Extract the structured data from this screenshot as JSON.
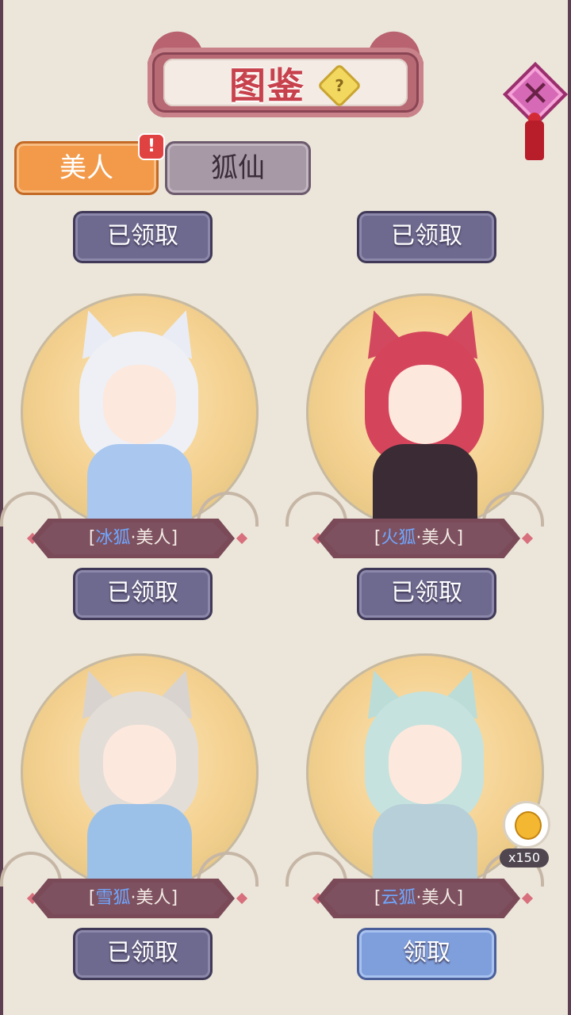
{
  "header": {
    "title": "图鉴",
    "help_icon": "?"
  },
  "close_icon": "✕",
  "tabs": [
    {
      "label": "美人",
      "active": true,
      "alert": "!"
    },
    {
      "label": "狐仙",
      "active": false
    }
  ],
  "top_row_buttons": [
    "已领取",
    "已领取"
  ],
  "cards": [
    {
      "prefix": "[",
      "fox": "冰狐",
      "dot": "·",
      "title": "美人",
      "suffix": "]",
      "button": "已领取",
      "claimed": true
    },
    {
      "prefix": "[",
      "fox": "火狐",
      "dot": "·",
      "title": "美人",
      "suffix": "]",
      "button": "已领取",
      "claimed": true
    },
    {
      "prefix": "[",
      "fox": "雪狐",
      "dot": "·",
      "title": "美人",
      "suffix": "]",
      "button": "已领取",
      "claimed": true
    },
    {
      "prefix": "[",
      "fox": "云狐",
      "dot": "·",
      "title": "美人",
      "suffix": "]",
      "button": "领取",
      "claimed": false
    }
  ],
  "reward": {
    "icon": "gold-coin-icon",
    "count": "x150"
  },
  "colors": {
    "accent_tab": "#f39a4a",
    "claim_button": "#7f9fdc",
    "claimed_button": "#6e6a8f",
    "fox_name": "#6fa7ff"
  }
}
